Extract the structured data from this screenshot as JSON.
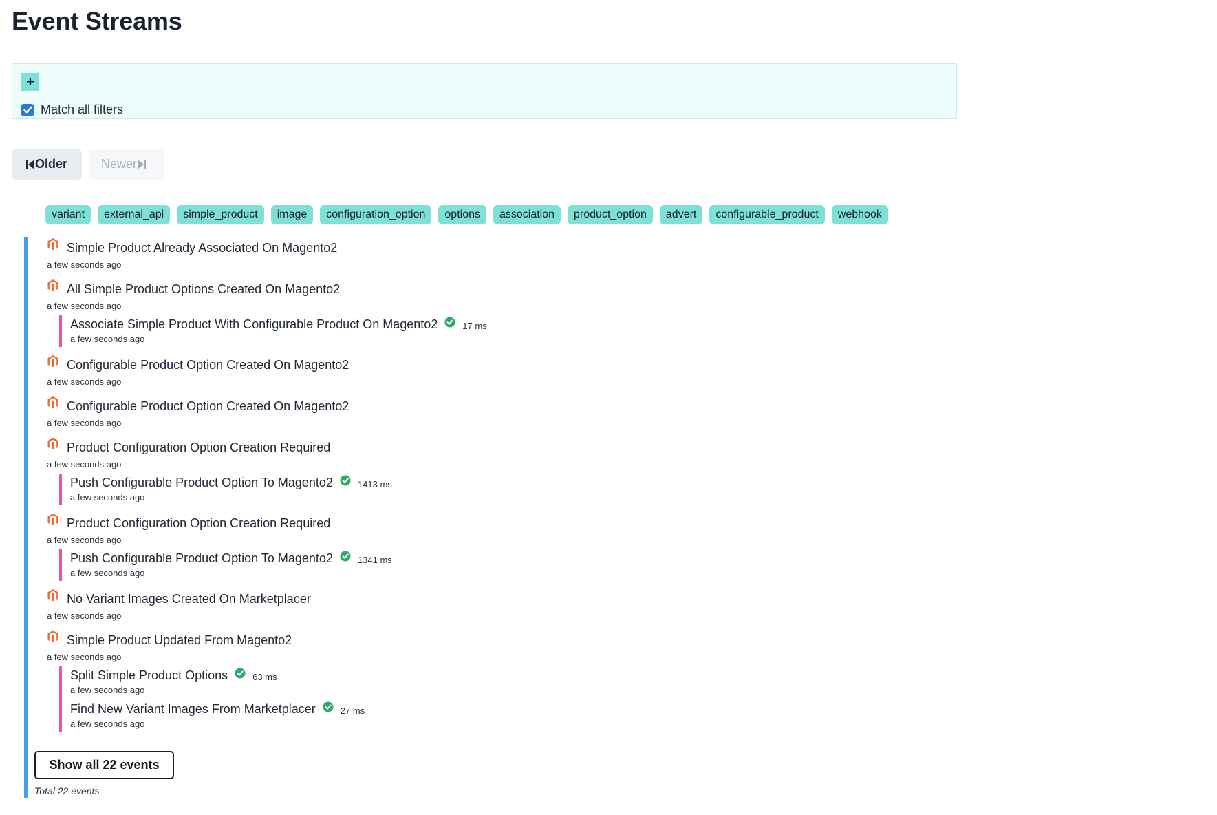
{
  "page": {
    "title": "Event Streams"
  },
  "filters": {
    "add_label": "+",
    "match_all_label": "Match all filters",
    "match_all_checked": true
  },
  "pager": {
    "older_label": "Older",
    "newer_label": "Newer"
  },
  "tags": [
    "variant",
    "external_api",
    "simple_product",
    "image",
    "configuration_option",
    "options",
    "association",
    "product_option",
    "advert",
    "configurable_product",
    "webhook"
  ],
  "events": [
    {
      "icon": "magento-icon",
      "title": "Simple Product Already Associated On Magento2",
      "time": "a few seconds ago",
      "subs": []
    },
    {
      "icon": "magento-icon",
      "title": "All Simple Product Options Created On Magento2",
      "time": "a few seconds ago",
      "subs": [
        {
          "title": "Associate Simple Product With Configurable Product On Magento2",
          "status": "success",
          "duration": "17 ms",
          "time": "a few seconds ago"
        }
      ]
    },
    {
      "icon": "magento-icon",
      "title": "Configurable Product Option Created On Magento2",
      "time": "a few seconds ago",
      "subs": []
    },
    {
      "icon": "magento-icon",
      "title": "Configurable Product Option Created On Magento2",
      "time": "a few seconds ago",
      "subs": []
    },
    {
      "icon": "magento-icon",
      "title": "Product Configuration Option Creation Required",
      "time": "a few seconds ago",
      "subs": [
        {
          "title": "Push Configurable Product Option To Magento2",
          "status": "success",
          "duration": "1413 ms",
          "time": "a few seconds ago"
        }
      ]
    },
    {
      "icon": "magento-icon",
      "title": "Product Configuration Option Creation Required",
      "time": "a few seconds ago",
      "subs": [
        {
          "title": "Push Configurable Product Option To Magento2",
          "status": "success",
          "duration": "1341 ms",
          "time": "a few seconds ago"
        }
      ]
    },
    {
      "icon": "magento-icon",
      "title": "No Variant Images Created On Marketplacer",
      "time": "a few seconds ago",
      "subs": []
    },
    {
      "icon": "magento-icon",
      "title": "Simple Product Updated From Magento2",
      "time": "a few seconds ago",
      "subs": [
        {
          "title": "Split Simple Product Options",
          "status": "success",
          "duration": "63 ms",
          "time": "a few seconds ago"
        },
        {
          "title": "Find New Variant Images From Marketplacer",
          "status": "success",
          "duration": "27 ms",
          "time": "a few seconds ago"
        }
      ]
    }
  ],
  "footer": {
    "show_all_label": "Show all 22 events",
    "total_label": "Total 22 events"
  },
  "colors": {
    "accent_tag": "#7fe1d6",
    "timeline": "#4a9fe3",
    "sub_bar": "#e8589a",
    "magento": "#ee672f",
    "success": "#2fa869",
    "checkbox": "#2f78d6"
  }
}
